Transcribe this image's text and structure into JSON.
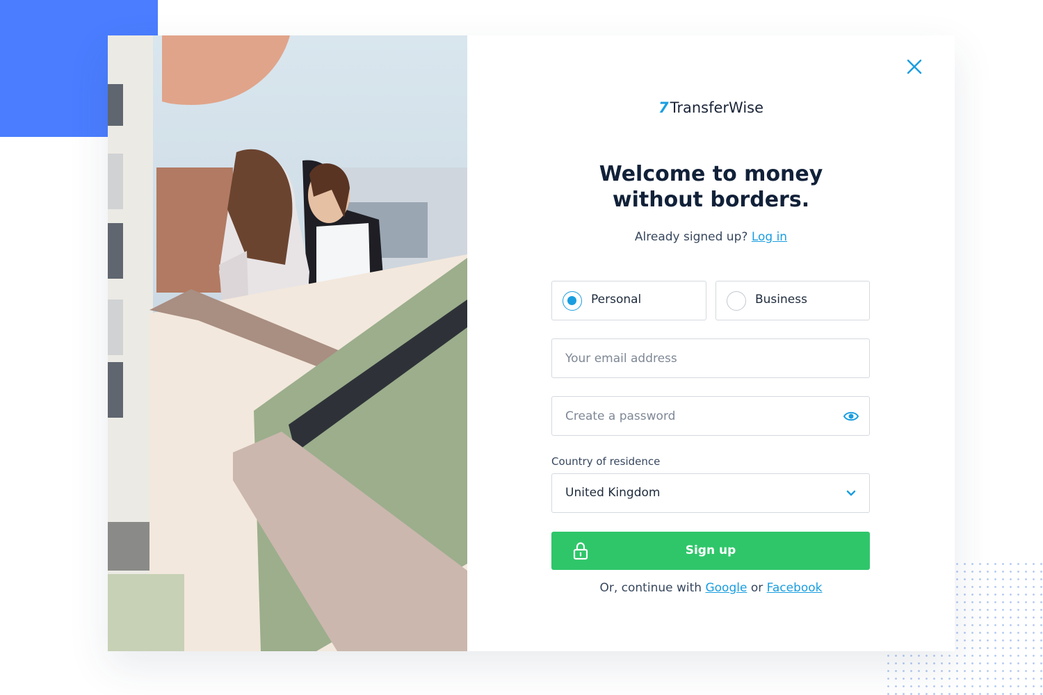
{
  "colors": {
    "accent": "#1a9ee0",
    "cta": "#2fc66a",
    "heading": "#112139",
    "deco_blue": "#4a7dff"
  },
  "close": {
    "icon": "close-icon"
  },
  "logo": {
    "mark": "7",
    "name": "TransferWise"
  },
  "headline": "Welcome to money without borders.",
  "login_prompt": {
    "text": "Already signed up? ",
    "link": "Log in"
  },
  "account_type": {
    "options": [
      {
        "label": "Personal",
        "selected": true
      },
      {
        "label": "Business",
        "selected": false
      }
    ]
  },
  "email": {
    "placeholder": "Your email address",
    "value": ""
  },
  "password": {
    "placeholder": "Create a password",
    "value": "",
    "icon": "eye-icon"
  },
  "country": {
    "label": "Country of residence",
    "value": "United Kingdom",
    "icon": "chevron-down-icon"
  },
  "signup": {
    "label": "Sign up",
    "icon": "lock-icon"
  },
  "social": {
    "prefix": "Or, continue with ",
    "google": "Google",
    "middle": " or ",
    "facebook": "Facebook"
  }
}
